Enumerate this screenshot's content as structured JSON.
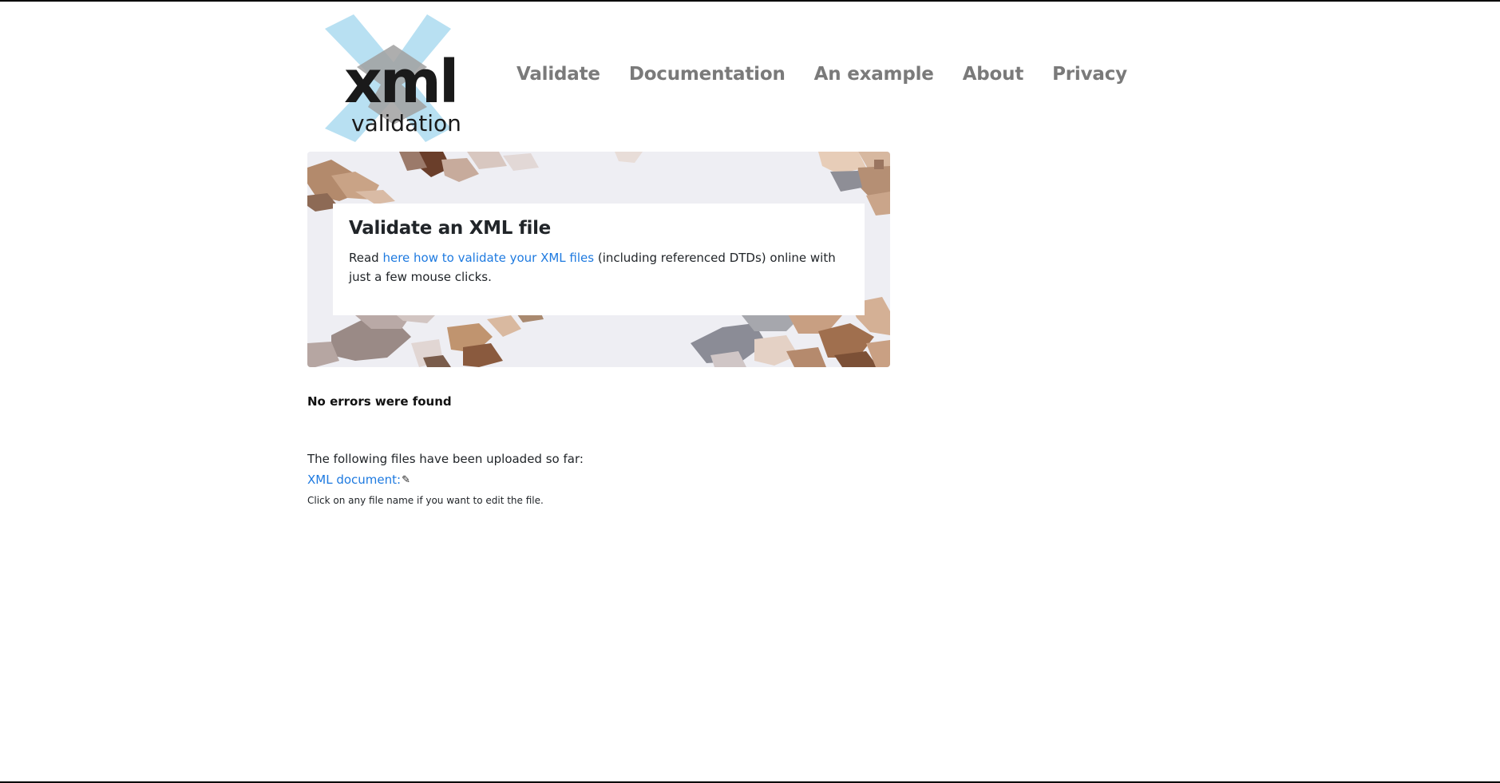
{
  "logo": {
    "main_text": "xml",
    "sub_text": "validation",
    "accent_color": "#b8e0f2",
    "shadow_color": "#9a9a9a",
    "text_color": "#1a1a1a"
  },
  "nav": {
    "items": [
      {
        "label": "Validate"
      },
      {
        "label": "Documentation"
      },
      {
        "label": "An example"
      },
      {
        "label": "About"
      },
      {
        "label": "Privacy"
      }
    ]
  },
  "hero": {
    "title": "Validate an XML file",
    "text_before": "Read ",
    "link_text": "here how to validate your XML files",
    "text_after": " (including referenced DTDs) online with just a few mouse clicks."
  },
  "result": {
    "status": "No errors were found",
    "uploaded_label": "The following files have been uploaded so far:",
    "file_link": "XML document:",
    "edit_icon": "pencil-icon",
    "hint": "Click on any file name if you want to edit the file."
  },
  "colors": {
    "link": "#1e7ae0",
    "nav": "#7a7a7a",
    "text": "#212529"
  }
}
